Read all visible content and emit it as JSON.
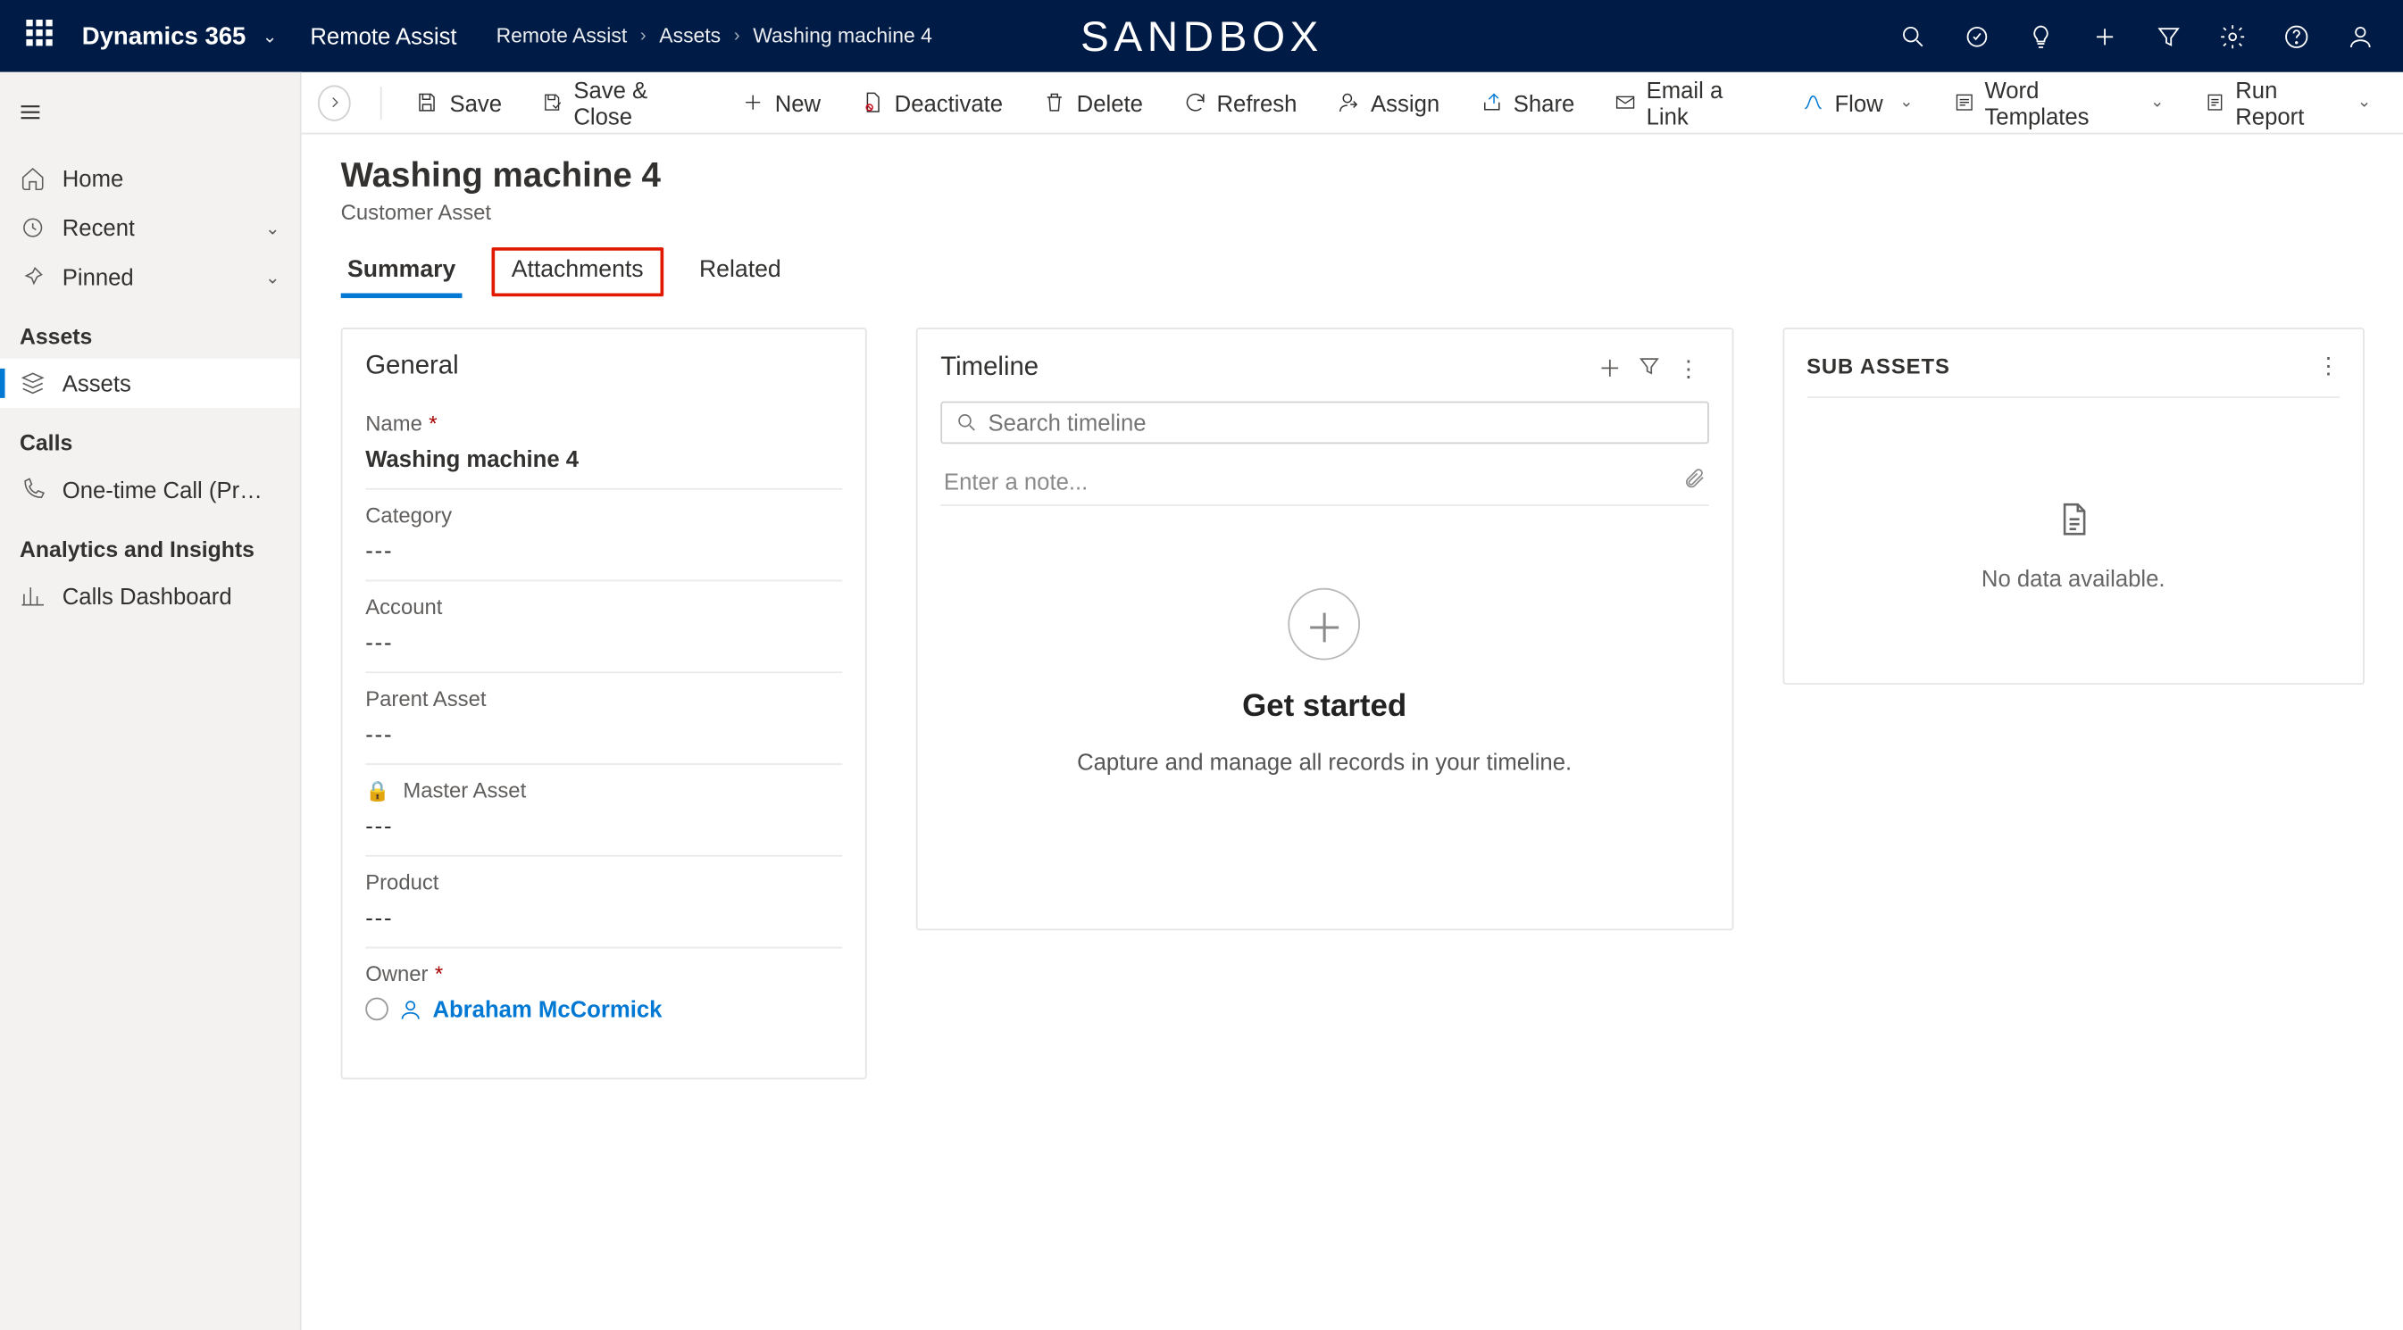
{
  "topbar": {
    "brand": "Dynamics 365",
    "app": "Remote Assist",
    "center": "SANDBOX",
    "breadcrumb": [
      "Remote Assist",
      "Assets",
      "Washing machine 4"
    ]
  },
  "sidebar": {
    "home": "Home",
    "recent": "Recent",
    "pinned": "Pinned",
    "groups": {
      "assets": {
        "title": "Assets",
        "items": [
          "Assets"
        ]
      },
      "calls": {
        "title": "Calls",
        "items": [
          "One-time Call (Previe..."
        ]
      },
      "analytics": {
        "title": "Analytics and Insights",
        "items": [
          "Calls Dashboard"
        ]
      }
    }
  },
  "commands": {
    "save": "Save",
    "saveClose": "Save & Close",
    "new": "New",
    "deactivate": "Deactivate",
    "delete": "Delete",
    "refresh": "Refresh",
    "assign": "Assign",
    "share": "Share",
    "email": "Email a Link",
    "flow": "Flow",
    "wordTemplates": "Word Templates",
    "runReport": "Run Report"
  },
  "page": {
    "title": "Washing machine  4",
    "subtitle": "Customer Asset",
    "tabs": {
      "summary": "Summary",
      "attachments": "Attachments",
      "related": "Related"
    }
  },
  "general": {
    "title": "General",
    "fields": {
      "name": {
        "label": "Name",
        "value": "Washing machine  4",
        "required": true
      },
      "category": {
        "label": "Category",
        "value": "---"
      },
      "account": {
        "label": "Account",
        "value": "---"
      },
      "parent": {
        "label": "Parent Asset",
        "value": "---"
      },
      "master": {
        "label": "Master Asset",
        "value": "---",
        "locked": true
      },
      "product": {
        "label": "Product",
        "value": "---"
      },
      "owner": {
        "label": "Owner",
        "value": "Abraham McCormick",
        "required": true
      }
    }
  },
  "timeline": {
    "title": "Timeline",
    "searchPlaceholder": "Search timeline",
    "notePlaceholder": "Enter a note...",
    "emptyTitle": "Get started",
    "emptyText": "Capture and manage all records in your timeline."
  },
  "subassets": {
    "title": "SUB ASSETS",
    "empty": "No data available."
  }
}
